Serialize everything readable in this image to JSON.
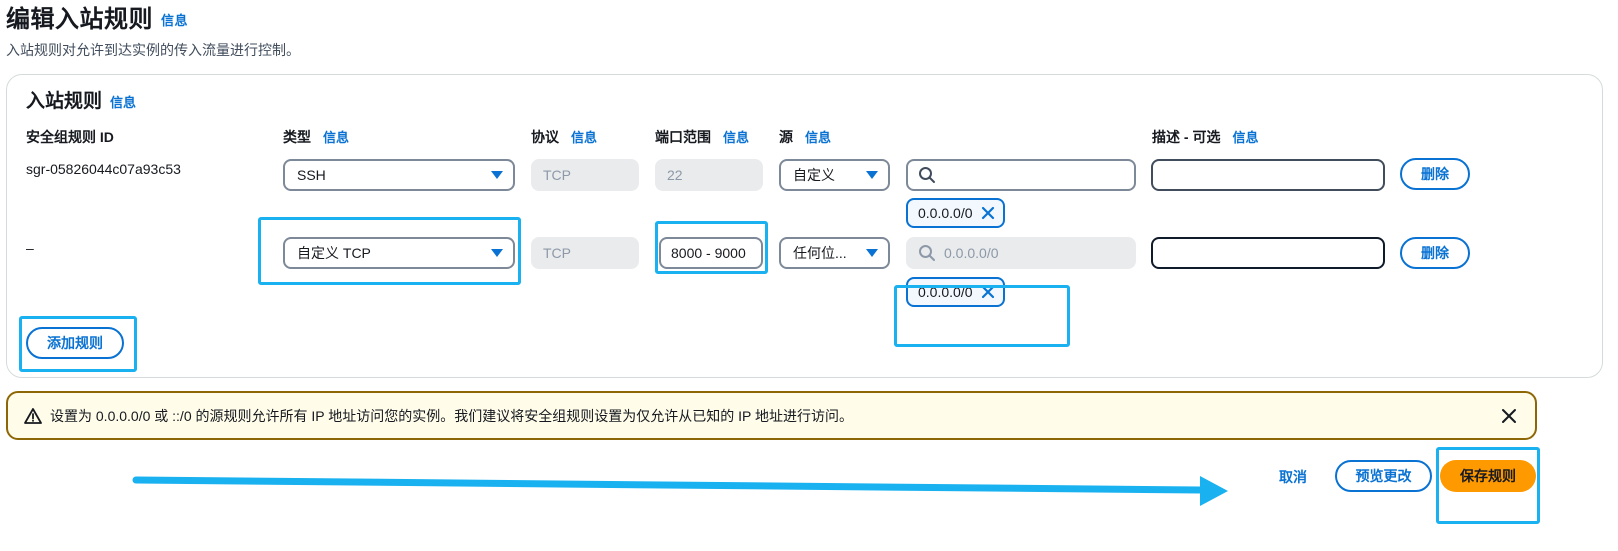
{
  "header": {
    "title": "编辑入站规则",
    "info": "信息",
    "description": "入站规则对允许到达实例的传入流量进行控制。"
  },
  "card": {
    "title": "入站规则",
    "info": "信息",
    "columns": {
      "rule_id": "安全组规则 ID",
      "type": "类型",
      "protocol": "协议",
      "port_range": "端口范围",
      "source": "源",
      "description": "描述 - 可选",
      "info": "信息"
    },
    "rows": [
      {
        "rule_id": "sgr-05826044c07a93c53",
        "type": "SSH",
        "protocol": "TCP",
        "port_range": "22",
        "source": "自定义",
        "search_value": "",
        "token": "0.0.0.0/0",
        "description": "",
        "delete": "删除"
      },
      {
        "rule_id": "–",
        "type": "自定义 TCP",
        "protocol": "TCP",
        "port_range": "8000 - 9000",
        "source": "任何位...",
        "search_placeholder": "0.0.0.0/0",
        "token": "0.0.0.0/0",
        "description": "",
        "delete": "删除"
      }
    ],
    "add_rule": "添加规则"
  },
  "alert": {
    "text": "设置为 0.0.0.0/0 或 ::/0 的源规则允许所有 IP 地址访问您的实例。我们建议将安全组规则设置为仅允许从已知的 IP 地址进行访问。"
  },
  "footer": {
    "cancel": "取消",
    "preview": "预览更改",
    "save": "保存规则"
  },
  "colors": {
    "link": "#0972d3",
    "primary": "#ff9900",
    "annotation": "#19b1f0",
    "alert_border": "#8d6605",
    "alert_bg": "#fffce9"
  },
  "icons": [
    "search-icon",
    "close-icon",
    "warning-icon",
    "chevron-down-icon",
    "arrow-right-icon"
  ]
}
